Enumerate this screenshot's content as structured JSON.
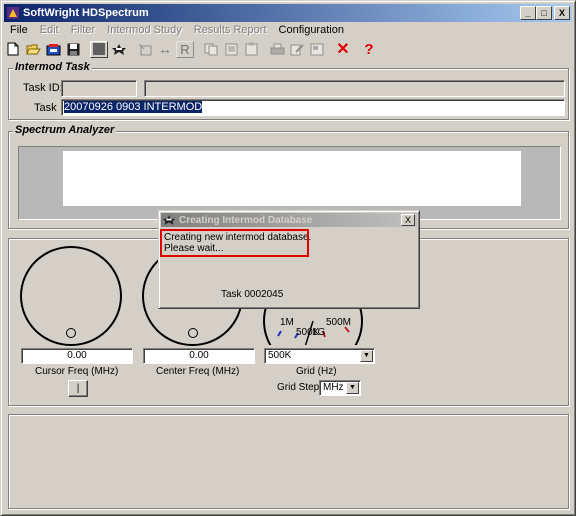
{
  "window": {
    "title": "SoftWright HDSpectrum"
  },
  "window_controls": {
    "minimize": "_",
    "maximize": "□",
    "close": "X"
  },
  "menu": [
    {
      "label": "File",
      "enabled": true
    },
    {
      "label": "Edit",
      "enabled": false
    },
    {
      "label": "Filter",
      "enabled": false
    },
    {
      "label": "Intermod Study",
      "enabled": false
    },
    {
      "label": "Results Report",
      "enabled": false
    },
    {
      "label": "Configuration",
      "enabled": true
    }
  ],
  "toolbar": {
    "icons": [
      "new-file-icon",
      "open-folder-icon",
      "open-database-icon",
      "save-icon",
      "stop-icon",
      "aircraft-icon",
      "export-icon",
      "span-icon",
      "reference-icon",
      "copy-icon",
      "paste-icon",
      "clipboard-icon",
      "print-icon",
      "edit-icon",
      "preview-icon",
      "delete-icon",
      "help-icon"
    ],
    "span_glyph": "↔",
    "reference_glyph": "R",
    "delete_glyph": "✕",
    "help_glyph": "?"
  },
  "intermod_task": {
    "title": "Intermod Task",
    "task_id_label": "Task ID:",
    "task_id_value": "",
    "task_id_description": "",
    "task_label": "Task",
    "task_value": "20070926 0903 INTERMOD"
  },
  "spectrum_analyzer": {
    "title": "Spectrum Analyzer"
  },
  "controls": {
    "cursor_freq_value": "0.00",
    "cursor_freq_label": "Cursor Freq (MHz)",
    "center_freq_value": "0.00",
    "center_freq_label": "Center Freq (MHz)",
    "cursor_button_label": "|",
    "grid_knob_labels": {
      "a": "1M",
      "b": "500K",
      "c": "1G",
      "d": "500M"
    },
    "grid_value": "500K",
    "grid_label": "Grid (Hz)",
    "grid_step_label": "Grid Step",
    "grid_step_value": "MHz"
  },
  "dialog": {
    "title": "Creating Intermod Database",
    "message_line1": "Creating new intermod database.",
    "message_line2": "Please wait...",
    "task_text": "Task 0002045"
  },
  "colors": {
    "titlebar_start": "#0a246a",
    "titlebar_end": "#a6caf0",
    "highlight_border": "#e00000",
    "delete_red": "#e00000"
  }
}
